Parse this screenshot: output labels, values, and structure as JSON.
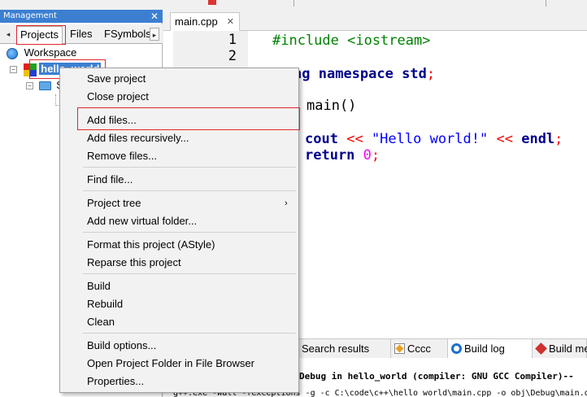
{
  "management": {
    "title": "Management",
    "close": "✕",
    "tabs": [
      "Projects",
      "Files",
      "FSymbols"
    ],
    "arrow_left": "◂",
    "arrow_right": "▸",
    "workspace": "Workspace",
    "project": "hello_world",
    "sources_label": "S"
  },
  "editor": {
    "tab_label": "main.cpp",
    "tab_close": "✕",
    "line_numbers": [
      "1",
      "2"
    ],
    "code": {
      "line1": "#include <iostream>",
      "line3_tail": "ng",
      "line3_kw": "namespace",
      "line3_std": "std",
      "line3_semi": ";",
      "line5_func": "main()",
      "line7_cout": "cout",
      "line7_op1": "<<",
      "line7_str": "\"Hello world!\"",
      "line7_op2": "<<",
      "line7_endl": "endl",
      "line7_semi": ";",
      "line8_return": "return",
      "line8_num": "0",
      "line8_semi": ";"
    }
  },
  "context_menu": {
    "items": [
      "Save project",
      "Close project",
      "Add files...",
      "Add files recursively...",
      "Remove files...",
      "Find file...",
      "Project tree",
      "Add new virtual folder...",
      "Format this project (AStyle)",
      "Reparse this project",
      "Build",
      "Rebuild",
      "Clean",
      "Build options...",
      "Open Project Folder in File Browser",
      "Properties..."
    ],
    "submenu_arrow": "›"
  },
  "logs": {
    "tabs": [
      "Search results",
      "Cccc",
      "Build log",
      "Build me"
    ],
    "line1": "Debug in hello_world (compiler: GNU GCC Compiler)--",
    "line2": "g++.exe -Wall -fexceptions -g  -c C:\\code\\c++\\hello_world\\main.cpp -o obj\\Debug\\main.o"
  },
  "colors": {
    "title_bar": "#3c7fd1",
    "highlight_box": "#e0262e",
    "preprocessor": "#008000",
    "keyword": "#00008b",
    "string": "#0000ff",
    "number": "#ff00ff",
    "operator": "#ff0000"
  }
}
